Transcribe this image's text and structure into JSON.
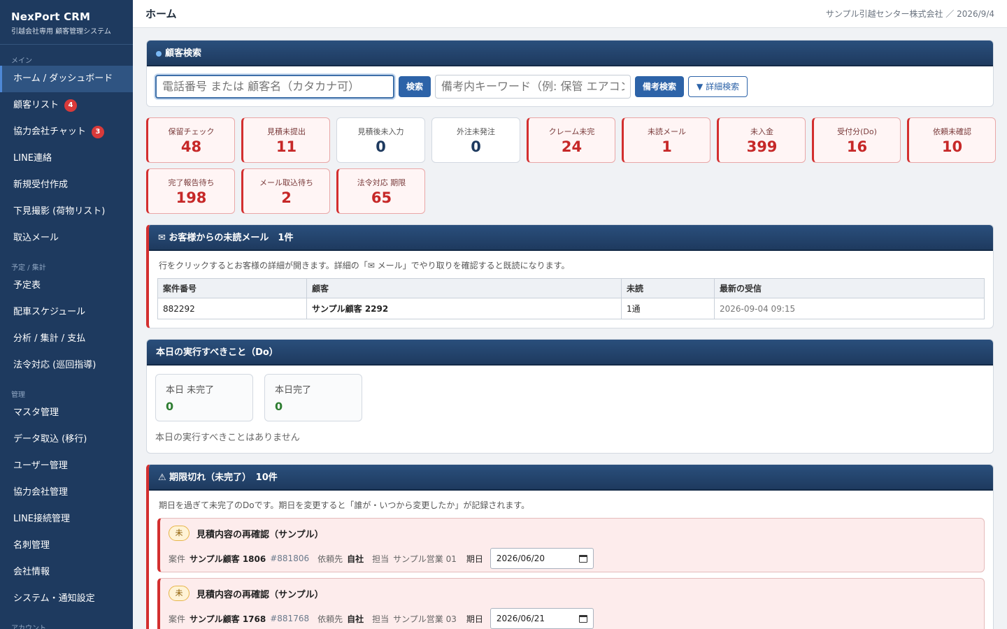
{
  "brand": {
    "title": "NexPort CRM",
    "subtitle": "引越会社専用 顧客管理システム"
  },
  "sidebar": {
    "sections": [
      {
        "label": "メイン",
        "items": [
          {
            "label": "ホーム / ダッシュボード",
            "active": true
          },
          {
            "label": "顧客リスト",
            "badge": "4"
          },
          {
            "label": "協力会社チャット",
            "badge": "3"
          },
          {
            "label": "LINE連絡"
          },
          {
            "label": "新規受付作成"
          },
          {
            "label": "下見撮影 (荷物リスト)"
          },
          {
            "label": "取込メール"
          }
        ]
      },
      {
        "label": "予定 / 集計",
        "items": [
          {
            "label": "予定表"
          },
          {
            "label": "配車スケジュール"
          },
          {
            "label": "分析 / 集計 / 支払"
          },
          {
            "label": "法令対応 (巡回指導)"
          }
        ]
      },
      {
        "label": "管理",
        "items": [
          {
            "label": "マスタ管理"
          },
          {
            "label": "データ取込 (移行)"
          },
          {
            "label": "ユーザー管理"
          },
          {
            "label": "協力会社管理"
          },
          {
            "label": "LINE接続管理"
          },
          {
            "label": "名刺管理"
          },
          {
            "label": "会社情報"
          },
          {
            "label": "システム・通知設定"
          }
        ]
      },
      {
        "label": "アカウント",
        "items": []
      }
    ]
  },
  "header": {
    "title": "ホーム",
    "right": "サンプル引越センター株式会社 ／ 2026/9/4"
  },
  "search": {
    "title": "顧客検索",
    "phone_placeholder": "電話番号 または 顧客名（カタカナ可）",
    "search_label": "検索",
    "note_placeholder": "備考内キーワード（例: 保管 エアコン）",
    "note_search_label": "備考検索",
    "advanced_label": "▼ 詳細検索"
  },
  "stats": [
    {
      "label": "保留チェック",
      "value": "48",
      "alert": true
    },
    {
      "label": "見積未提出",
      "value": "11",
      "alert": true
    },
    {
      "label": "見積後未入力",
      "value": "0",
      "alert": false
    },
    {
      "label": "外注未発注",
      "value": "0",
      "alert": false
    },
    {
      "label": "クレーム未完",
      "value": "24",
      "alert": true
    },
    {
      "label": "未読メール",
      "value": "1",
      "alert": true
    },
    {
      "label": "未入金",
      "value": "399",
      "alert": true
    },
    {
      "label": "受付分(Do)",
      "value": "16",
      "alert": true
    },
    {
      "label": "依頼未確認",
      "value": "10",
      "alert": true
    },
    {
      "label": "完了報告待ち",
      "value": "198",
      "alert": true
    },
    {
      "label": "メール取込待ち",
      "value": "2",
      "alert": true
    },
    {
      "label": "法令対応 期限",
      "value": "65",
      "alert": true
    }
  ],
  "unread": {
    "title": "✉ お客様からの未読メール　1件",
    "note": "行をクリックするとお客様の詳細が開きます。詳細の「✉ メール」でやり取りを確認すると既読になります。",
    "columns": [
      "案件番号",
      "顧客",
      "未読",
      "最新の受信"
    ],
    "rows": [
      {
        "id": "882292",
        "customer": "サンプル顧客 2292",
        "unread": "1通",
        "received": "2026-09-04 09:15"
      }
    ]
  },
  "today": {
    "title": "本日の実行すべきこと（Do）",
    "incomplete_label": "本日 未完了",
    "incomplete_value": "0",
    "complete_label": "本日完了",
    "complete_value": "0",
    "empty": "本日の実行すべきことはありません"
  },
  "overdue": {
    "title": "⚠ 期限切れ（未完了）　10件",
    "note": "期日を過ぎて未完了のDoです。期日を変更すると「誰が・いつから変更したか」が記録されます。",
    "tasks": [
      {
        "badge": "未",
        "title": "見積内容の再確認（サンプル）",
        "case_label": "案件",
        "customer": "サンプル顧客 1806",
        "case_id": "#881806",
        "requester_label": "依頼先",
        "requester": "自社",
        "owner_label": "担当",
        "owner": "サンプル営業 01",
        "due_label": "期日",
        "due": "2026/06/20"
      },
      {
        "badge": "未",
        "title": "見積内容の再確認（サンプル）",
        "case_label": "案件",
        "customer": "サンプル顧客 1768",
        "case_id": "#881768",
        "requester_label": "依頼先",
        "requester": "自社",
        "owner_label": "担当",
        "owner": "サンプル営業 03",
        "due_label": "期日",
        "due": "2026/06/21"
      }
    ]
  }
}
